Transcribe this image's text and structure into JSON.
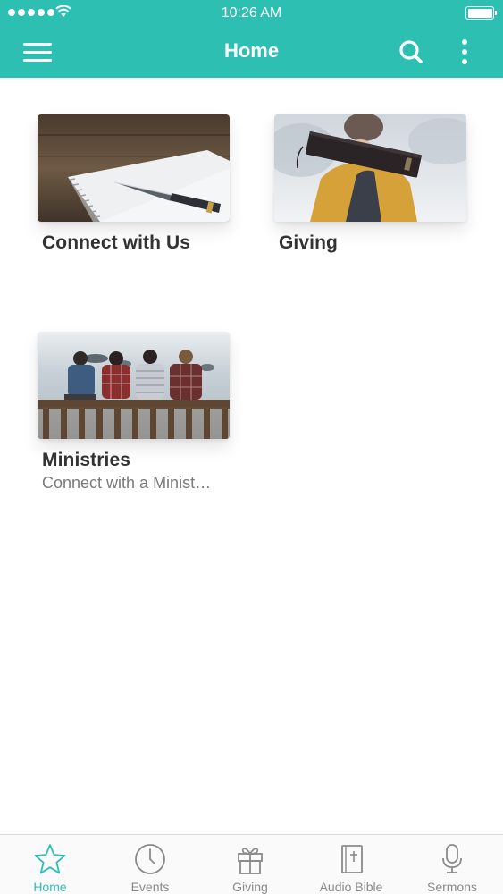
{
  "status_bar": {
    "time": "10:26 AM"
  },
  "header": {
    "title": "Home",
    "icons": [
      "menu-icon",
      "search-icon",
      "more-vertical-icon"
    ]
  },
  "tiles": [
    {
      "title": "Connect with Us",
      "subtitle": "",
      "image": "notebook-pen-photo"
    },
    {
      "title": "Giving",
      "subtitle": "",
      "image": "person-holding-bible-photo"
    },
    {
      "title": "Ministries",
      "subtitle": "Connect with a Minist…",
      "image": "friends-sitting-on-railing-photo"
    }
  ],
  "tabbar": {
    "items": [
      {
        "label": "Home",
        "icon": "star-icon",
        "active": true
      },
      {
        "label": "Events",
        "icon": "clock-icon",
        "active": false
      },
      {
        "label": "Giving",
        "icon": "gift-icon",
        "active": false
      },
      {
        "label": "Audio Bible",
        "icon": "bible-icon",
        "active": false
      },
      {
        "label": "Sermons",
        "icon": "microphone-icon",
        "active": false
      }
    ]
  },
  "colors": {
    "brand": "#2dbfb2",
    "tab_inactive": "#8a8a8a",
    "title_text": "#333333"
  }
}
